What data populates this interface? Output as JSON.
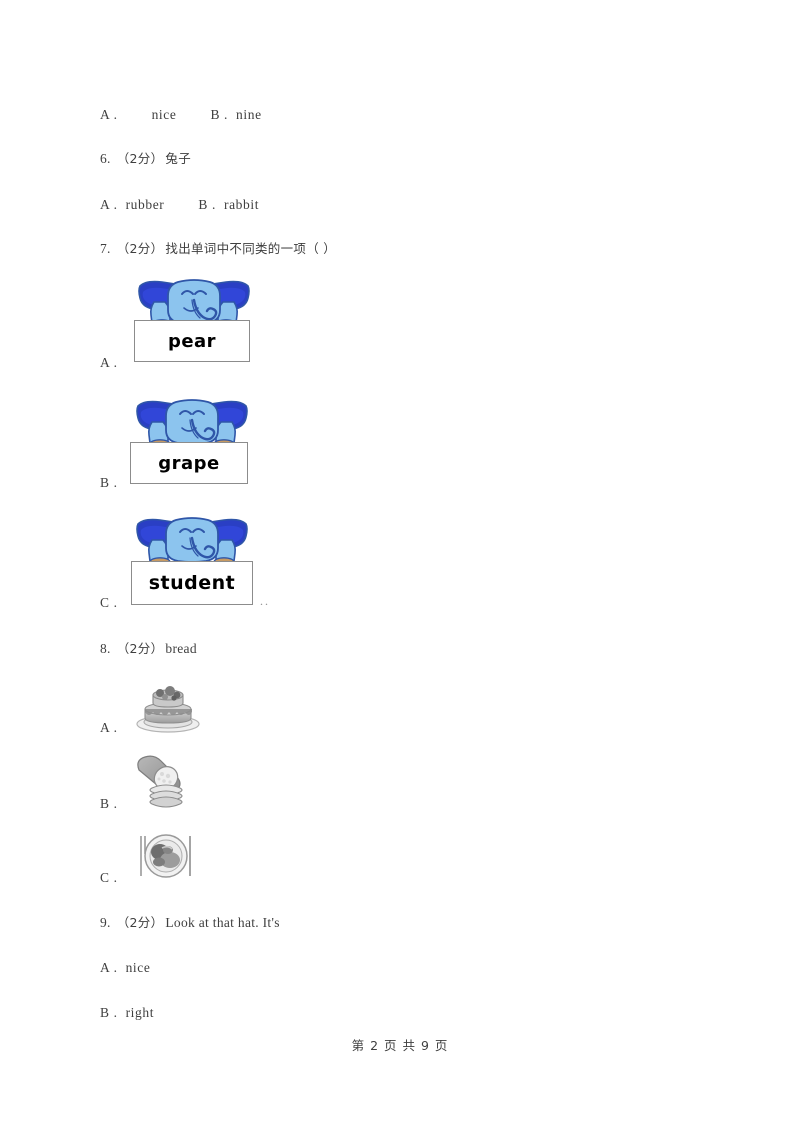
{
  "document": {
    "page_label": "第 2 页 共 9 页",
    "page_number": "2",
    "total_pages": "9"
  },
  "questions": [
    {
      "id": "q5-options",
      "type": "text-options",
      "options": [
        {
          "letter": "A .",
          "text": "nice"
        },
        {
          "letter": "B .",
          "text": "nine"
        }
      ]
    },
    {
      "id": "q6",
      "number": "6.",
      "score": "（2分）",
      "prompt": "兔子",
      "options": [
        {
          "letter": "A .",
          "text": "rubber"
        },
        {
          "letter": "B .",
          "text": "rabbit"
        }
      ]
    },
    {
      "id": "q7",
      "number": "7.",
      "score": "（2分）",
      "prompt": "找出单词中不同类的一项（      ）",
      "options": [
        {
          "letter": "A .",
          "word": "pear",
          "image": "elephant-holding-word-card"
        },
        {
          "letter": "B .",
          "word": "grape",
          "image": "elephant-holding-word-card"
        },
        {
          "letter": "C .",
          "word": "student",
          "image": "elephant-holding-word-card",
          "trailing": ".."
        }
      ]
    },
    {
      "id": "q8",
      "number": "8.",
      "score": "（2分）",
      "prompt": "bread",
      "options": [
        {
          "letter": "A .",
          "image": "cake-photo"
        },
        {
          "letter": "B .",
          "image": "bread-loaf-photo"
        },
        {
          "letter": "C .",
          "image": "plate-of-food-photo"
        }
      ]
    },
    {
      "id": "q9",
      "number": "9.",
      "score": "（2分）",
      "prompt": "Look at that hat. It's",
      "options": [
        {
          "letter": "A .",
          "text": "nice"
        },
        {
          "letter": "B .",
          "text": "right"
        }
      ]
    }
  ],
  "colors": {
    "page_background": "#ffffff",
    "text": "#3f3f3f",
    "card_border": "#8c8c8c",
    "elephant_body": "#8cc4ee",
    "elephant_ear": "#2a3fc4",
    "elephant_outline": "#2f56a8",
    "elephant_foot": "#c79a63"
  }
}
